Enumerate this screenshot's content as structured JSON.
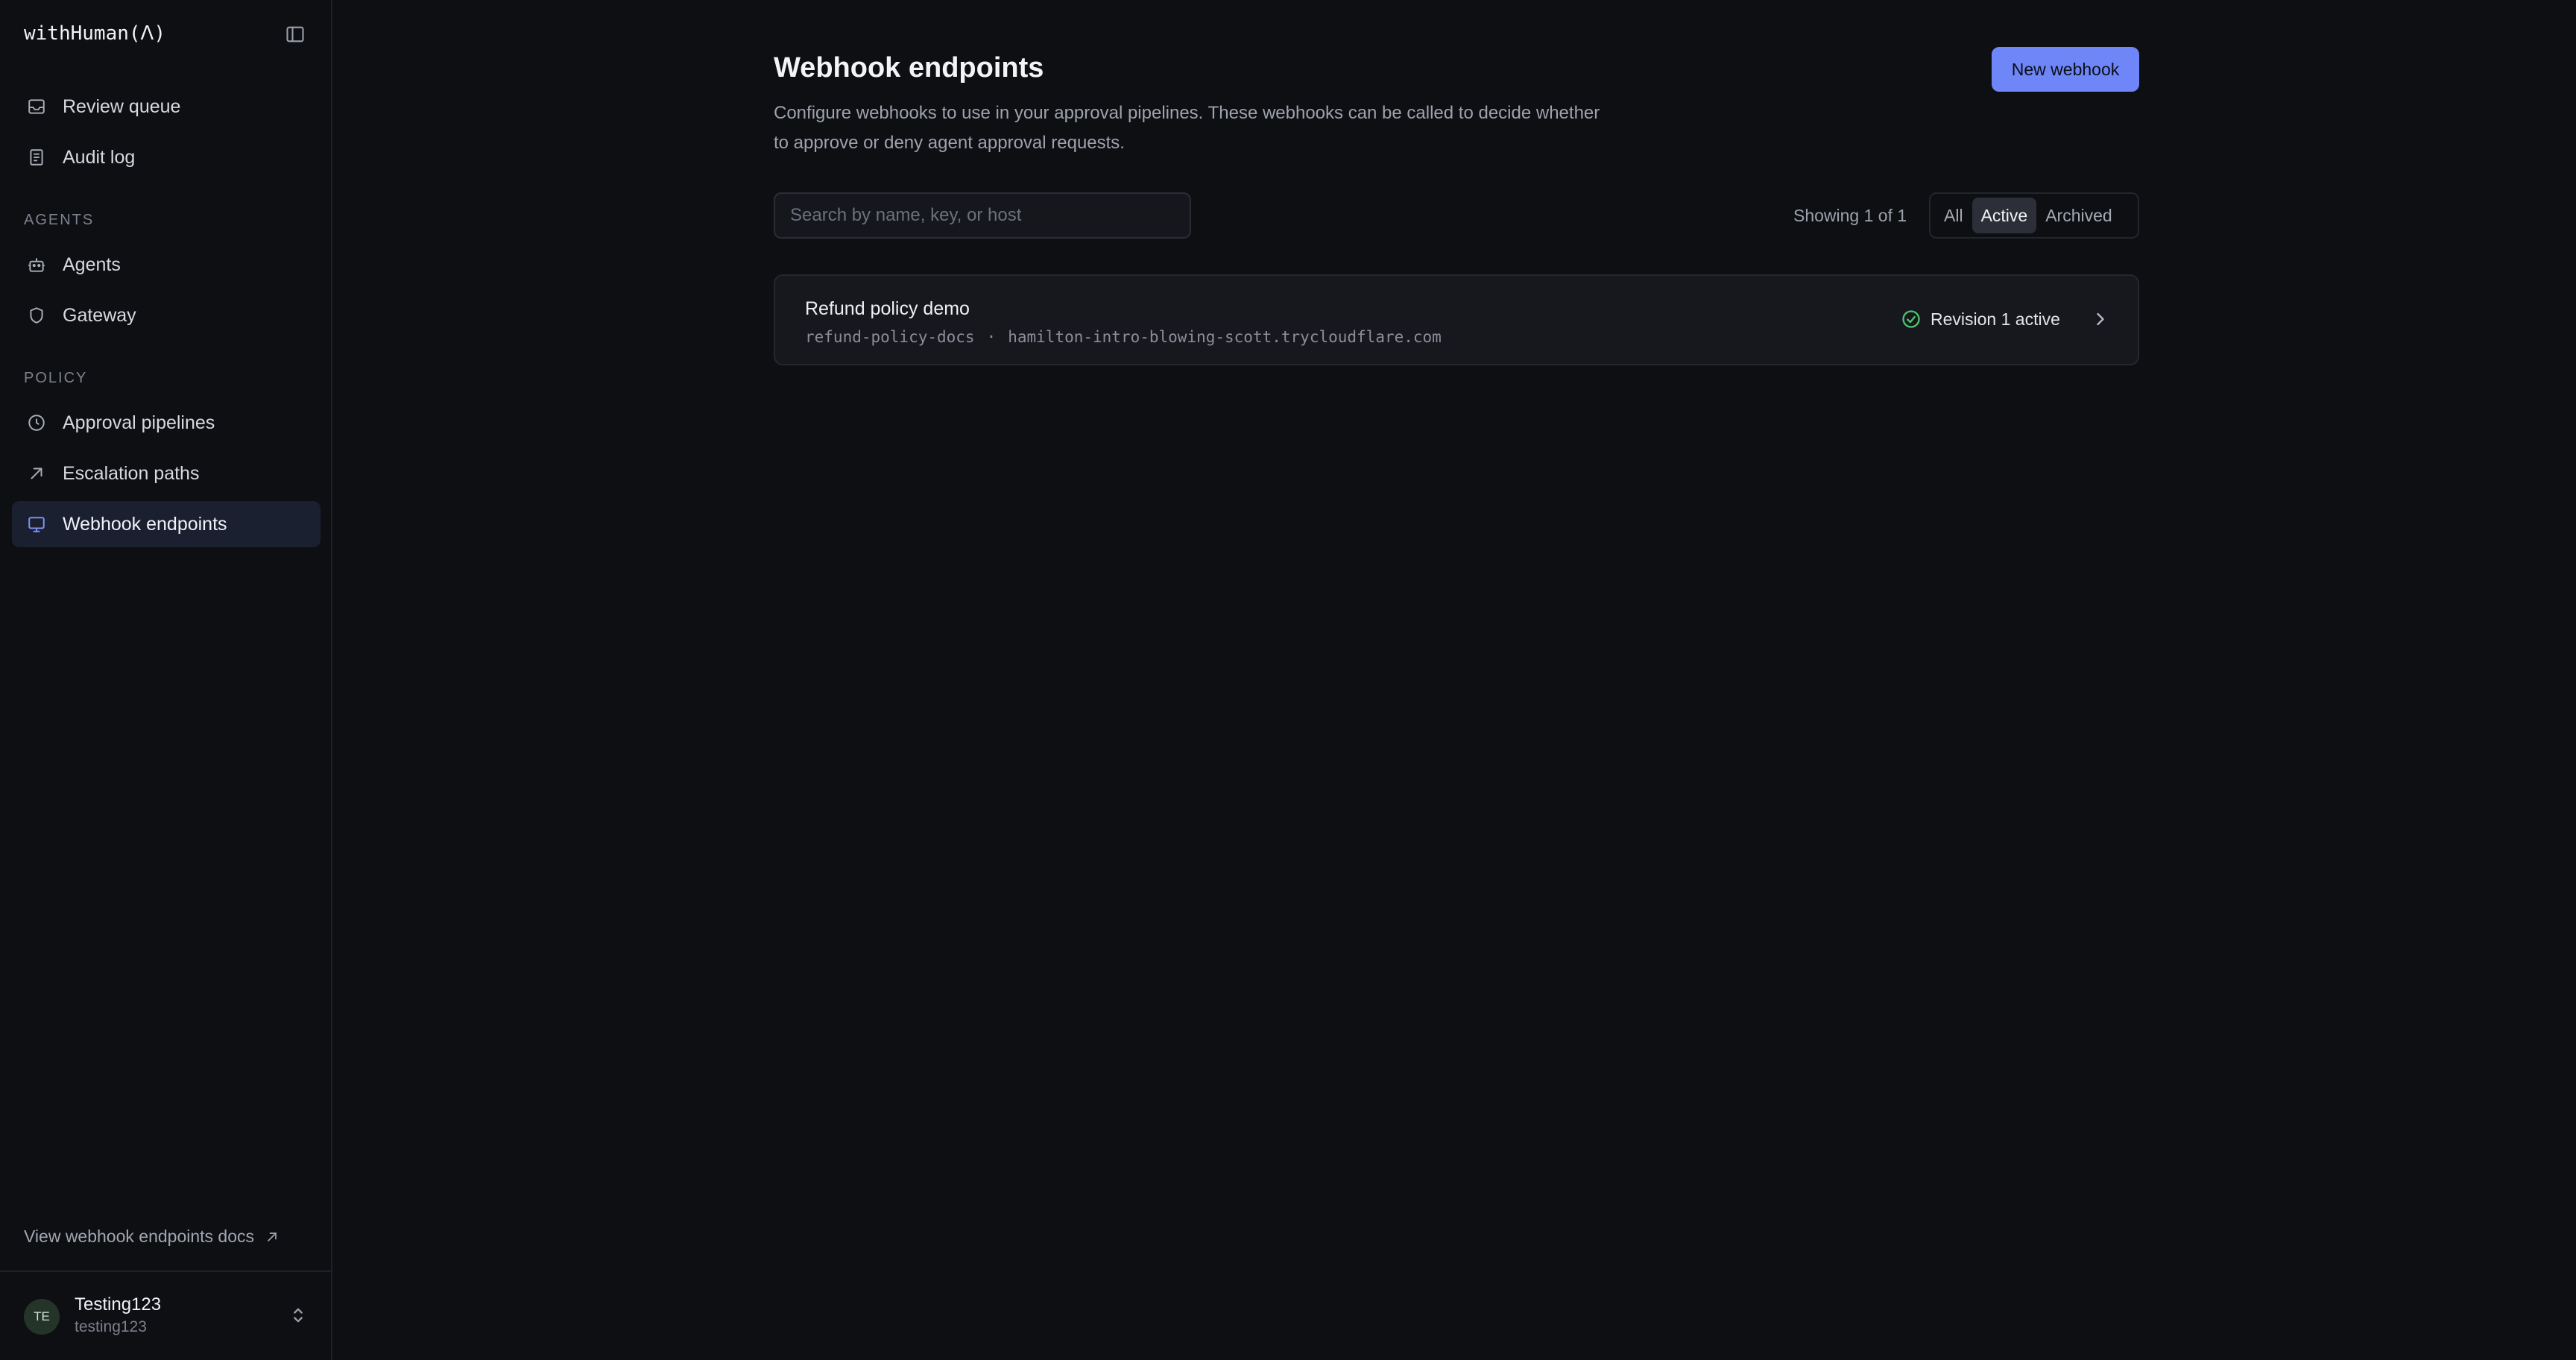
{
  "app": {
    "brand": "withHuman(ᐱ)"
  },
  "sidebar": {
    "items_top": [
      {
        "label": "Review queue",
        "icon": "inbox-icon"
      },
      {
        "label": "Audit log",
        "icon": "document-icon"
      }
    ],
    "sections": [
      {
        "label": "AGENTS",
        "items": [
          {
            "label": "Agents",
            "icon": "robot-icon"
          },
          {
            "label": "Gateway",
            "icon": "shield-icon"
          }
        ]
      },
      {
        "label": "POLICY",
        "items": [
          {
            "label": "Approval pipelines",
            "icon": "clock-icon"
          },
          {
            "label": "Escalation paths",
            "icon": "arrow-up-right-icon"
          },
          {
            "label": "Webhook endpoints",
            "icon": "monitor-icon",
            "active": true
          }
        ]
      }
    ],
    "docs_link": "View webhook endpoints docs",
    "user": {
      "initials": "TE",
      "name": "Testing123",
      "handle": "testing123"
    }
  },
  "main": {
    "title": "Webhook endpoints",
    "description": "Configure webhooks to use in your approval pipelines. These webhooks can be called to decide whether to approve or deny agent approval requests.",
    "new_button": "New webhook",
    "search_placeholder": "Search by name, key, or host",
    "showing": "Showing 1 of 1",
    "filters": [
      {
        "label": "All",
        "active": false
      },
      {
        "label": "Active",
        "active": true
      },
      {
        "label": "Archived",
        "active": false
      }
    ],
    "endpoints": [
      {
        "name": "Refund policy demo",
        "key": "refund-policy-docs",
        "separator": "·",
        "host": "hamilton-intro-blowing-scott.trycloudflare.com",
        "status": "Revision 1 active"
      }
    ]
  },
  "colors": {
    "background": "#0e0f13",
    "accent": "#6e86f7",
    "active_nav": "#1b2030",
    "success": "#4ec46b"
  }
}
